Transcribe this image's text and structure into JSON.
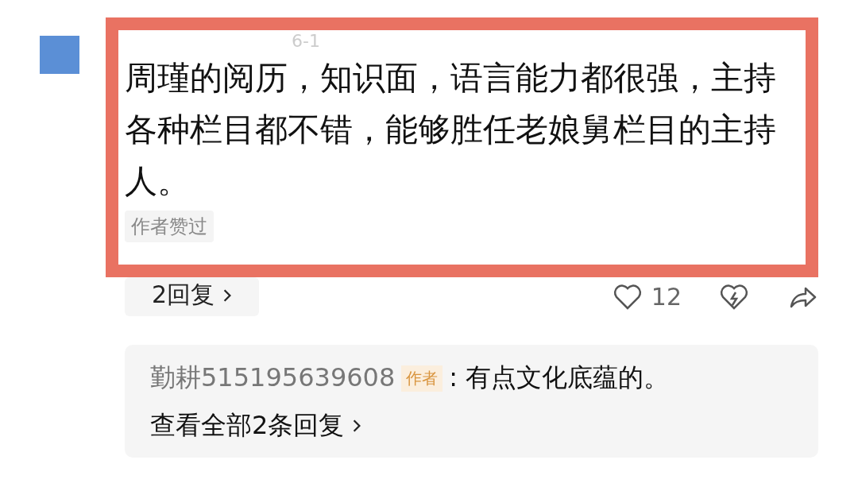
{
  "comment": {
    "date": "6-1",
    "text": "周瑾的阅历，知识面，语言能力都很强，主持各种栏目都不错，能够胜任老娘舅栏目的主持人。",
    "author_liked_tag": "作者赞过",
    "reply_button": "2回复",
    "like_count": "12"
  },
  "reply_preview": {
    "username": "勤耕515195639608",
    "author_tag": "作者",
    "text": ": 有点文化底蕴的。",
    "view_all": "查看全部2条回复"
  }
}
